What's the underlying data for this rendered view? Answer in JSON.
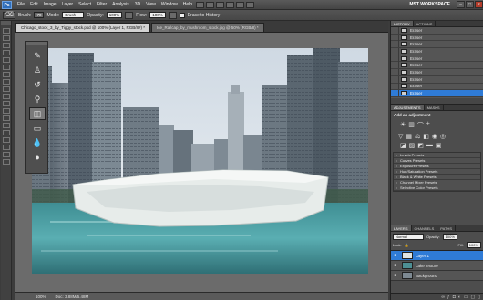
{
  "app": {
    "logo": "Ps"
  },
  "menu": [
    "File",
    "Edit",
    "Image",
    "Layer",
    "Select",
    "Filter",
    "Analysis",
    "3D",
    "View",
    "Window",
    "Help"
  ],
  "workspace_label": "MST WORKSPACE",
  "window_buttons": [
    "–",
    "□",
    "×"
  ],
  "options": {
    "brush_label": "Brush:",
    "brush_size": "70",
    "mode_label": "Mode:",
    "mode_value": "Brush",
    "opacity_label": "Opacity:",
    "opacity_value": "100%",
    "flow_label": "Flow:",
    "flow_value": "100%",
    "erase_history": "Erase to History"
  },
  "tabs": [
    {
      "label": "Chicago_stock_3_by_Tiggy_stock.psd @ 100% (Layer 1, RGB/8#) *",
      "active": true
    },
    {
      "label": "Ice_Railcap_by_mushroom_stock.jpg @ 50% (RGB/8) *",
      "active": false
    }
  ],
  "status": {
    "zoom": "100%",
    "doc": "Doc: 3.88M/5.48M"
  },
  "history": {
    "tabs": [
      "HISTORY",
      "ACTIONS"
    ],
    "items": [
      "Eraser",
      "Eraser",
      "Eraser",
      "Eraser",
      "Eraser",
      "Eraser",
      "Eraser",
      "Eraser",
      "Eraser",
      "Eraser"
    ],
    "selected_index": 9
  },
  "adjustments": {
    "tabs": [
      "ADJUSTMENTS",
      "MASKS"
    ],
    "header": "Add an adjustment",
    "presets": [
      "Levels Presets",
      "Curves Presets",
      "Exposure Presets",
      "Hue/Saturation Presets",
      "Black & White Presets",
      "Channel Mixer Presets",
      "Selective Color Presets"
    ]
  },
  "layers": {
    "tabs": [
      "LAYERS",
      "CHANNELS",
      "PATHS"
    ],
    "blend_mode": "Normal",
    "opacity_label": "Opacity:",
    "opacity_value": "100%",
    "lock_label": "Lock:",
    "fill_label": "Fill:",
    "fill_value": "100%",
    "items": [
      {
        "name": "Layer 1",
        "selected": true
      },
      {
        "name": "Lake texture",
        "selected": false
      },
      {
        "name": "Background",
        "selected": false
      }
    ]
  },
  "colors": {
    "accent": "#2f7bd6",
    "ui_dark": "#3c3c3c"
  }
}
